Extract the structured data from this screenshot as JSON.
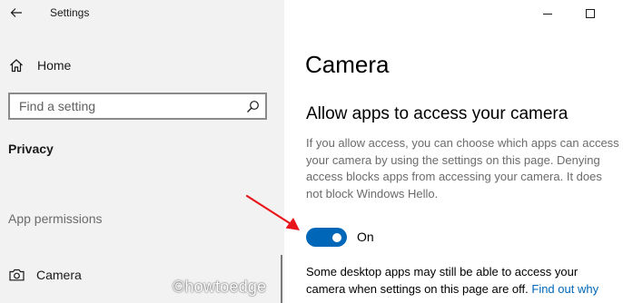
{
  "app": {
    "title": "Settings"
  },
  "nav": {
    "home_label": "Home",
    "search_placeholder": "Find a setting",
    "section_heading": "Privacy",
    "group_label": "App permissions",
    "camera_label": "Camera"
  },
  "content": {
    "title": "Camera",
    "section_title": "Allow apps to access your camera",
    "description": "If you allow access, you can choose which apps can access your camera by using the settings on this page. Denying access blocks apps from accessing your camera. It does not block Windows Hello.",
    "toggle": {
      "state_label": "On",
      "is_on": true
    },
    "note": "Some desktop apps may still be able to access your camera when settings on this page are off.",
    "link_label": "Find out why"
  },
  "watermark": "©howtoedge",
  "icons": {
    "back": "back-arrow-icon",
    "home": "home-icon",
    "search": "search-icon",
    "camera": "camera-icon",
    "minimize": "minimize-icon",
    "maximize": "maximize-icon"
  },
  "colors": {
    "accent": "#0067b8",
    "nav_background": "#f2f2f2",
    "annotation_arrow": "#e8161b"
  }
}
